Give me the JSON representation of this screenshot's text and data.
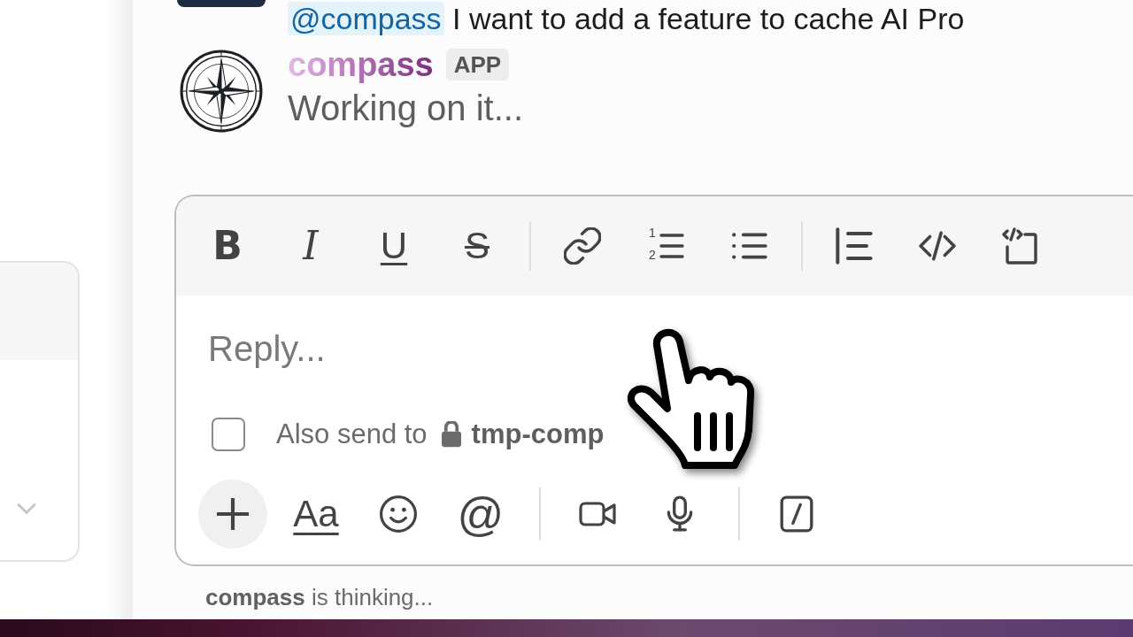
{
  "previous_message": {
    "mention": "@compass",
    "text": "I want to add a feature to cache AI Pro"
  },
  "message": {
    "sender": "compass",
    "badge": "APP",
    "text": "Working on it..."
  },
  "composer": {
    "formatting_groups": [
      [
        {
          "kind": "bold",
          "label": "B"
        },
        {
          "kind": "italic",
          "label": "I"
        },
        {
          "kind": "underline",
          "label": "U"
        },
        {
          "kind": "strikethrough",
          "label": "S"
        }
      ],
      [
        {
          "kind": "link"
        },
        {
          "kind": "ordered_list",
          "numerals": [
            "1",
            "2"
          ]
        },
        {
          "kind": "bulleted_list"
        }
      ],
      [
        {
          "kind": "blockquote"
        },
        {
          "kind": "code"
        },
        {
          "kind": "code_block"
        }
      ]
    ],
    "placeholder": "Reply...",
    "also_send": {
      "checked": false,
      "label": "Also send to",
      "channel": "tmp-comp"
    },
    "action_groups": [
      [
        {
          "kind": "attach"
        },
        {
          "kind": "format",
          "label": "Aa"
        },
        {
          "kind": "emoji"
        },
        {
          "kind": "mention",
          "label": "@"
        }
      ],
      [
        {
          "kind": "video"
        },
        {
          "kind": "audio"
        }
      ],
      [
        {
          "kind": "shortcuts"
        }
      ]
    ]
  },
  "status": "**compass** is thinking..."
}
